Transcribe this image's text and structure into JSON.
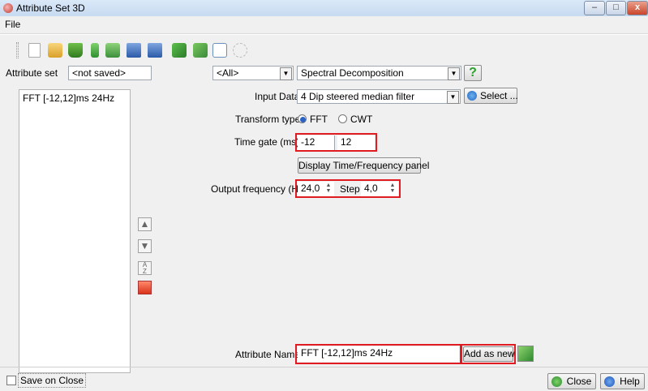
{
  "window": {
    "title": "Attribute Set 3D",
    "minimize_glyph": "–",
    "maximize_glyph": "□",
    "close_glyph": "x"
  },
  "menu": {
    "file": "File"
  },
  "toolbar": {
    "icons": [
      "new-icon",
      "open-icon",
      "open-default-icon",
      "wand-icon",
      "import-icon",
      "save-icon",
      "save-as-icon",
      "evaluate-icon",
      "cross-plot-icon",
      "graph-icon",
      "link-icon"
    ]
  },
  "attribute_set": {
    "label": "Attribute set",
    "value": "<not saved>"
  },
  "filter": {
    "value": "<All>"
  },
  "attribute_type": {
    "value": "Spectral Decomposition",
    "help_glyph": "?"
  },
  "list": {
    "items": [
      "FFT [-12,12]ms 24Hz"
    ]
  },
  "input_data": {
    "label": "Input Data",
    "value": "4 Dip steered median filter",
    "select_label": "Select ..."
  },
  "transform": {
    "label": "Transform type",
    "options": [
      "FFT",
      "CWT"
    ],
    "selected": "FFT"
  },
  "time_gate": {
    "label": "Time gate (ms)",
    "start": "-12",
    "stop": "12"
  },
  "display_panel": {
    "label": "Display Time/Frequency panel"
  },
  "output_frequency": {
    "label": "Output frequency (Hz",
    "value": "24,0",
    "step_label": "Step",
    "step": "4,0"
  },
  "side_buttons": {
    "icons": [
      "move-up-icon",
      "move-down-icon",
      "sort-icon",
      "remove-icon"
    ]
  },
  "attribute_name": {
    "label": "Attribute Name",
    "value": "FFT [-12,12]ms 24Hz",
    "add_label": "Add as new"
  },
  "footer": {
    "save_on_close": "Save on Close",
    "close": "Close",
    "help": "Help"
  },
  "colors": {
    "highlight": "#e11b22",
    "window_bg": "#f0f0f0"
  }
}
